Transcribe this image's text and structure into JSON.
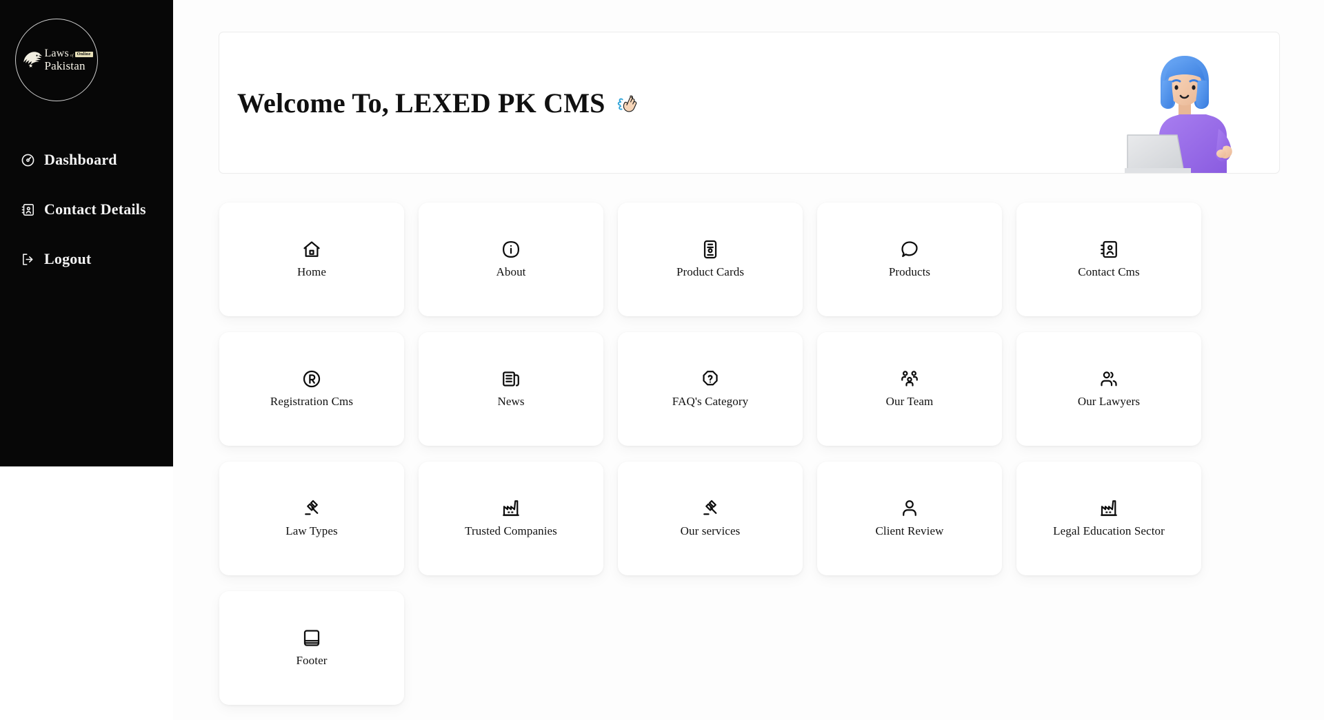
{
  "app": {
    "theme": {
      "sidebar_bg": "#070707",
      "sidebar_text": "#f2f2f2",
      "main_bg": "#fdfdfd",
      "card_bg": "#ffffff",
      "accent_cream": "#e6dfb8",
      "title_color": "#101010"
    }
  },
  "sidebar": {
    "logo": {
      "line_one": "Laws",
      "connector": "of",
      "badge": "Online",
      "line_two": "Pakistan",
      "icon": "eagle-head-icon"
    },
    "items": [
      {
        "label": "Dashboard",
        "icon": "dashboard-gauge-icon"
      },
      {
        "label": "Contact Details",
        "icon": "contact-book-icon"
      },
      {
        "label": "Logout",
        "icon": "logout-arrow-icon"
      }
    ]
  },
  "welcome": {
    "greeting": "Welcome To,",
    "brand": "LEXED PK CMS",
    "emoji": "waving-hand",
    "illustration": "woman-with-laptop-3d-illustration"
  },
  "cards": [
    {
      "label": "Home",
      "icon": "house-icon"
    },
    {
      "label": "About",
      "icon": "info-squircle-icon"
    },
    {
      "label": "Product Cards",
      "icon": "id-card-icon"
    },
    {
      "label": "Products",
      "icon": "teardrop-bubble-icon"
    },
    {
      "label": "Contact Cms",
      "icon": "address-book-icon"
    },
    {
      "label": "Registration Cms",
      "icon": "registered-trademark-icon"
    },
    {
      "label": "News",
      "icon": "newspaper-icon"
    },
    {
      "label": "FAQ's Category",
      "icon": "help-octagon-icon"
    },
    {
      "label": "Our Team",
      "icon": "users-three-icon"
    },
    {
      "label": "Our Lawyers",
      "icon": "users-two-icon"
    },
    {
      "label": "Law Types",
      "icon": "gavel-icon"
    },
    {
      "label": "Trusted Companies",
      "icon": "factory-icon"
    },
    {
      "label": "Our services",
      "icon": "gavel-icon"
    },
    {
      "label": "Client Review",
      "icon": "user-single-icon"
    },
    {
      "label": "Legal Education Sector",
      "icon": "factory-icon"
    },
    {
      "label": "Footer",
      "icon": "footer-layout-icon"
    }
  ]
}
